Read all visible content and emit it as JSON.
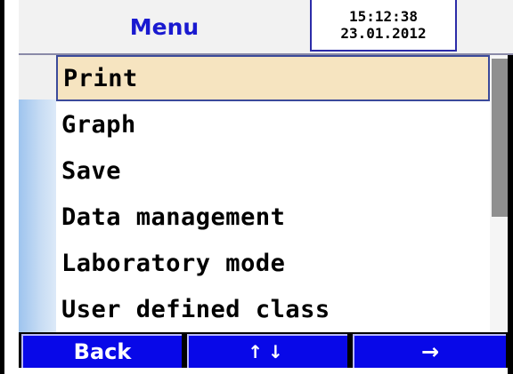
{
  "header": {
    "title": "Menu",
    "time": "15:12:38",
    "date": "23.01.2012"
  },
  "menu": {
    "items": [
      {
        "label": "Print",
        "selected": true
      },
      {
        "label": "Graph",
        "selected": false
      },
      {
        "label": "Save",
        "selected": false
      },
      {
        "label": "Data management",
        "selected": false
      },
      {
        "label": "Laboratory mode",
        "selected": false
      },
      {
        "label": "User defined class",
        "selected": false
      }
    ]
  },
  "softkeys": {
    "back": "Back",
    "updown": "↑↓",
    "next": "→"
  },
  "colors": {
    "title": "#1a1ad0",
    "button": "#0808e8",
    "selection": "#f6e4c0",
    "scroll_thumb": "#8f8f8f"
  }
}
